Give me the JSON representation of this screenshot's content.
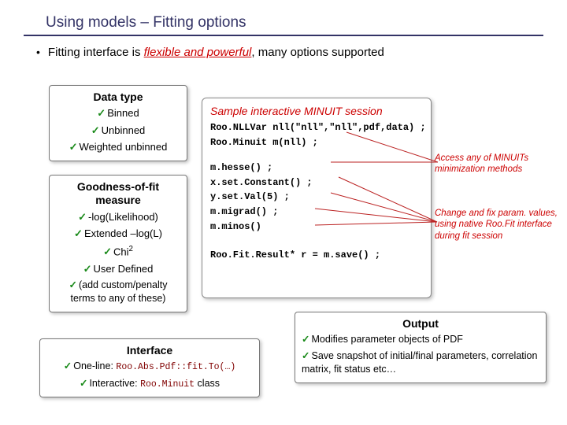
{
  "title": "Using models – Fitting options",
  "bullet": {
    "pre": "Fitting interface is ",
    "emph": "flexible and powerful",
    "post": ", many options supported"
  },
  "dataType": {
    "title": "Data type",
    "items": [
      "Binned",
      "Unbinned",
      "Weighted unbinned"
    ]
  },
  "gof": {
    "title": "Goodness-of-fit measure",
    "items": [
      "-log(Likelihood)",
      "Extended –log(L)"
    ],
    "chi_pre": "Chi",
    "chi_sup": "2",
    "user": "User Defined",
    "custom": "(add custom/penalty terms to any of these)"
  },
  "iface": {
    "title": "Interface",
    "line1_pre": "One-line: ",
    "line1_code": "Roo.Abs.Pdf::fit.To(…)",
    "line2_pre": "Interactive: ",
    "line2_code": "Roo.Minuit",
    "line2_post": " class"
  },
  "session": {
    "title": "Sample interactive MINUIT session",
    "l1": "Roo.NLLVar nll(\"nll\",\"nll\",pdf,data) ;",
    "l2": "Roo.Minuit m(nll) ;",
    "l3": "m.hesse() ;",
    "l4": "x.set.Constant() ;",
    "l5": "y.set.Val(5) ;",
    "l6": "m.migrad() ;",
    "l7": "m.minos()",
    "l8": "Roo.Fit.Result* r = m.save() ;"
  },
  "annot1": "Access any of MINUITs minimization methods",
  "annot2": "Change and fix param. values, using native Roo.Fit interface during fit session",
  "output": {
    "title": "Output",
    "i1": "Modifies parameter objects of PDF",
    "i2": "Save snapshot of initial/final parameters, correlation matrix, fit status etc…"
  }
}
